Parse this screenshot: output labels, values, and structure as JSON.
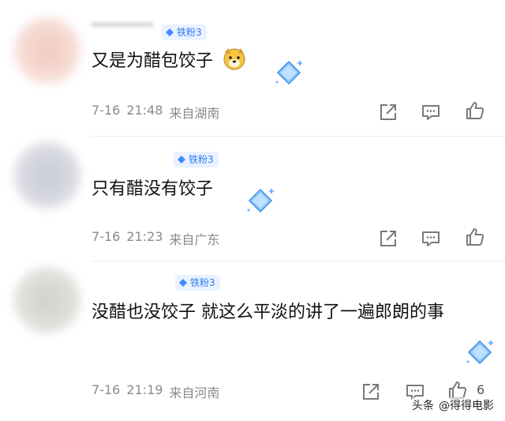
{
  "comments": [
    {
      "badge": "铁粉3",
      "text": "又是为醋包饺子",
      "date": "7-16",
      "time": "21:48",
      "location": "来自湖南",
      "like_count": ""
    },
    {
      "badge": "铁粉3",
      "text": "只有醋没有饺子",
      "date": "7-16",
      "time": "21:23",
      "location": "来自广东",
      "like_count": ""
    },
    {
      "badge": "铁粉3",
      "text": "没醋也没饺子 就这么平淡的讲了一遍郎朗的事",
      "date": "7-16",
      "time": "21:19",
      "location": "来自河南",
      "like_count": "6"
    }
  ],
  "watermark": {
    "source": "头条",
    "handle": "@得得电影"
  },
  "colors": {
    "badge_bg": "#e9f2ff",
    "badge_text": "#2f7bf5",
    "meta_text": "#8a8a8a",
    "icon_stroke": "#7a7a7a"
  },
  "icons": [
    "diamond-icon",
    "dog-emoji-icon",
    "sparkle-diamond-icon",
    "share-icon",
    "comment-icon",
    "like-icon"
  ]
}
